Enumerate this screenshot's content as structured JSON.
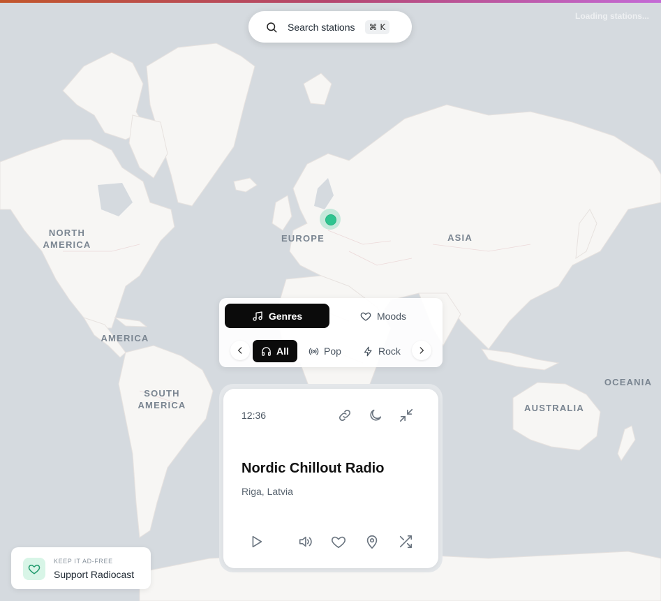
{
  "status": {
    "loading_text": "Loading stations..."
  },
  "search": {
    "label": "Search stations",
    "shortcut": "⌘ K",
    "icon": "search-icon"
  },
  "map": {
    "continents": {
      "north_america": "NORTH\nAMERICA",
      "america": "AMERICA",
      "south_america": "SOUTH\nAMERICA",
      "europe": "EUROPE",
      "asia": "ASIA",
      "oceania": "OCEANIA",
      "australia": "AUSTRALIA"
    },
    "marker_color": "#2ec48f"
  },
  "filters": {
    "tabs": [
      {
        "label": "Genres",
        "icon": "music-note-icon",
        "active": true
      },
      {
        "label": "Moods",
        "icon": "heart-icon",
        "active": false
      }
    ],
    "chips": [
      {
        "label": "All",
        "icon": "headphones-icon",
        "active": true
      },
      {
        "label": "Pop",
        "icon": "broadcast-icon",
        "active": false
      },
      {
        "label": "Rock",
        "icon": "lightning-icon",
        "active": false
      }
    ]
  },
  "player": {
    "time": "12:36",
    "station_name": "Nordic Chillout Radio",
    "location": "Riga, Latvia",
    "top_icons": [
      "link-icon",
      "moon-icon",
      "minimize-icon"
    ],
    "controls": [
      "play-icon",
      "volume-icon",
      "heart-icon",
      "map-pin-icon",
      "shuffle-icon"
    ]
  },
  "support": {
    "kicker": "KEEP IT AD-FREE",
    "title": "Support Radiocast"
  },
  "colors": {
    "accent_green": "#2ec48f",
    "ocean": "#d5dadf",
    "land": "#f7f6f4"
  }
}
